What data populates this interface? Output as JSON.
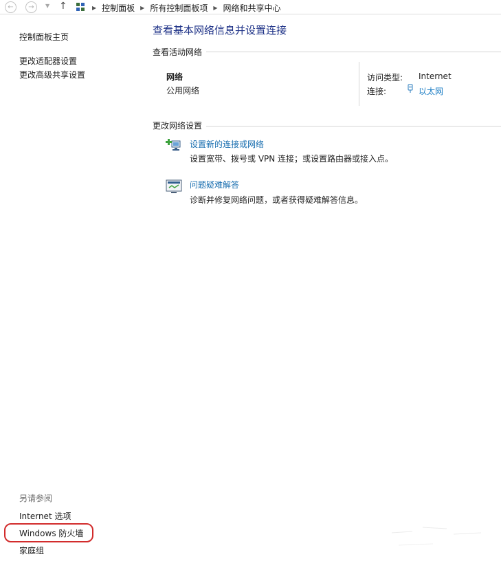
{
  "breadcrumb": {
    "items": [
      "控制面板",
      "所有控制面板项",
      "网络和共享中心"
    ]
  },
  "sidebar": {
    "home": "控制面板主页",
    "links": [
      "更改适配器设置",
      "更改高级共享设置"
    ],
    "see_also_heading": "另请参阅",
    "see_also": [
      "Internet 选项",
      "Windows 防火墙",
      "家庭组"
    ]
  },
  "main": {
    "title": "查看基本网络信息并设置连接",
    "active_networks_heading": "查看活动网络",
    "network": {
      "name": "网络",
      "type": "公用网络",
      "access_type_label": "访问类型:",
      "access_type_value": "Internet",
      "connection_label": "连接:",
      "connection_value": "以太网"
    },
    "change_settings_heading": "更改网络设置",
    "tasks": [
      {
        "icon": "new-connection-icon",
        "link": "设置新的连接或网络",
        "desc": "设置宽带、拨号或 VPN 连接；或设置路由器或接入点。"
      },
      {
        "icon": "troubleshoot-icon",
        "link": "问题疑难解答",
        "desc": "诊断并修复网络问题，或者获得疑难解答信息。"
      }
    ]
  },
  "colors": {
    "title": "#1e3287",
    "link": "#1a7cc4",
    "highlight": "#d22c2c"
  }
}
